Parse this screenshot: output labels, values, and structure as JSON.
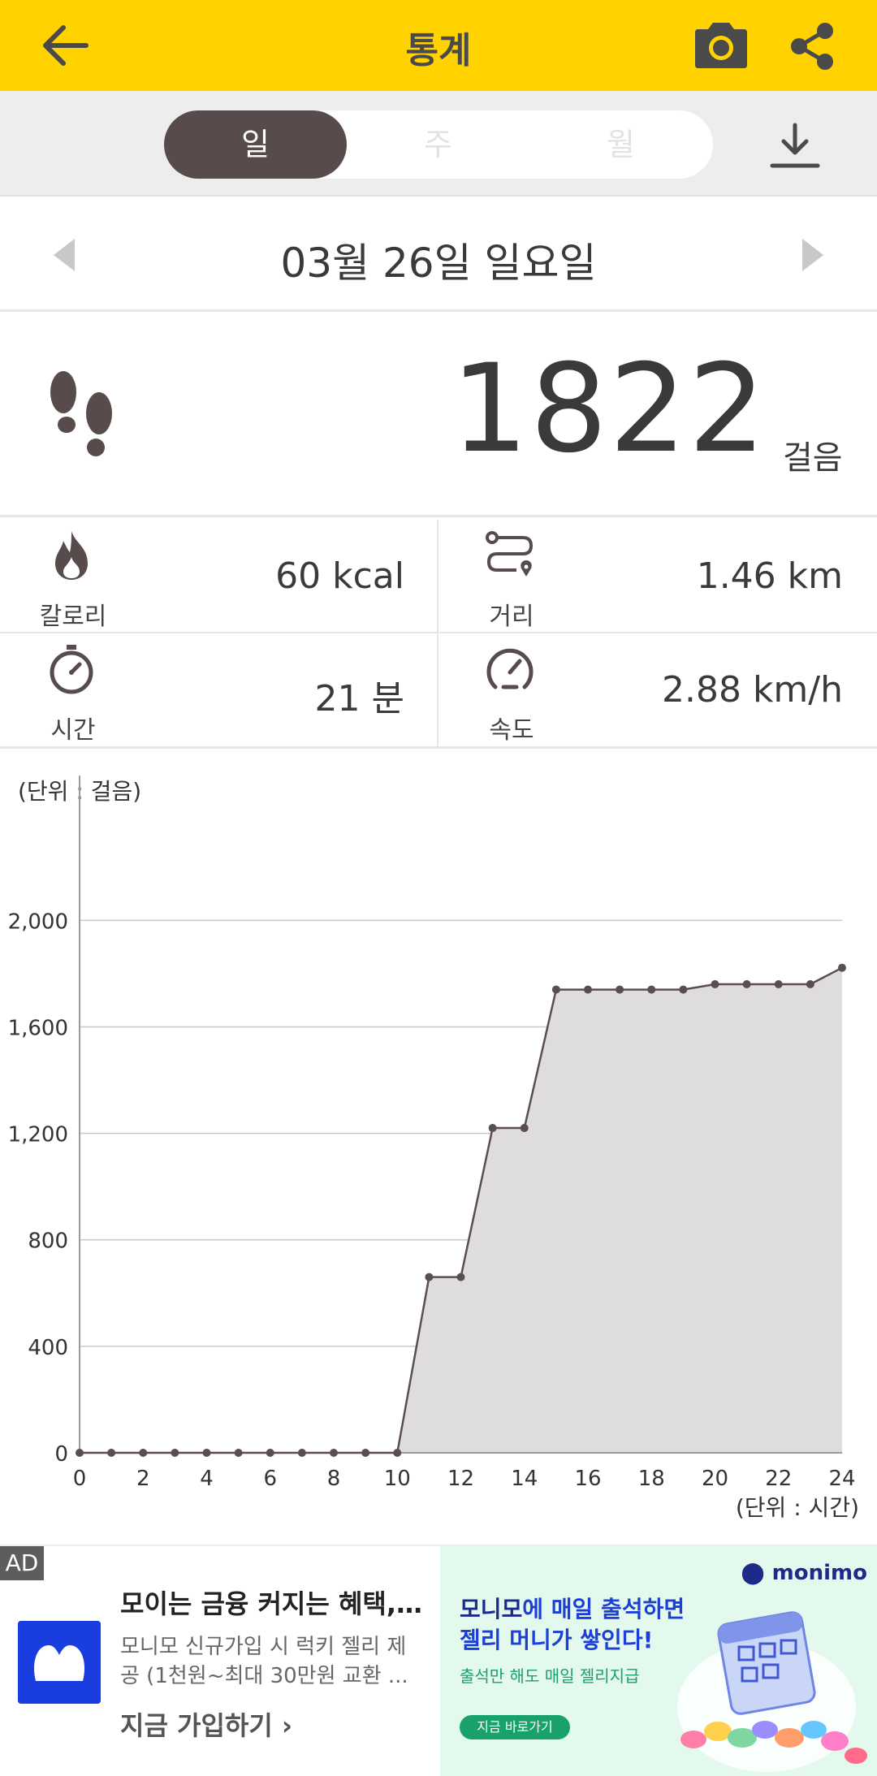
{
  "appbar": {
    "title": "통계"
  },
  "period_tabs": [
    "일",
    "주",
    "월"
  ],
  "active_tab": "일",
  "date": "03월 26일 일요일",
  "steps": {
    "count": "1822",
    "unit": "걸음"
  },
  "stats": {
    "calories": {
      "label": "칼로리",
      "value": "60 kcal"
    },
    "distance": {
      "label": "거리",
      "value": "1.46 km"
    },
    "time": {
      "label": "시간",
      "value": "21 분"
    },
    "speed": {
      "label": "속도",
      "value": "2.88 km/h"
    }
  },
  "chart_data": {
    "type": "area",
    "ylabel": "(단위 : 걸음)",
    "xlabel": "(단위 : 시간)",
    "x": [
      0,
      1,
      2,
      3,
      4,
      5,
      6,
      7,
      8,
      9,
      10,
      11,
      12,
      13,
      14,
      15,
      16,
      17,
      18,
      19,
      20,
      21,
      22,
      23,
      24
    ],
    "values": [
      0,
      0,
      0,
      0,
      0,
      0,
      0,
      0,
      0,
      0,
      0,
      660,
      660,
      1220,
      1220,
      1740,
      1740,
      1740,
      1740,
      1740,
      1760,
      1760,
      1760,
      1760,
      1822
    ],
    "xticks": [
      "0",
      "2",
      "4",
      "6",
      "8",
      "10",
      "12",
      "14",
      "16",
      "18",
      "20",
      "22",
      "24"
    ],
    "yticks": [
      "0",
      "400",
      "800",
      "1,200",
      "1,600",
      "2,000"
    ],
    "ylim": [
      0,
      2300
    ],
    "xlim": [
      0,
      24
    ],
    "grid": true,
    "colors": {
      "line": "#5a4e4e",
      "fill": "#dedcdc"
    }
  },
  "ad": {
    "tag": "AD",
    "headline": "모이는 금융 커지는 혜택, ...",
    "body_line1": "모니모 신규가입 시 럭키 젤리 제",
    "body_line2": "공 (1천원~최대 30만원 교환 ...",
    "cta": "지금 가입하기",
    "banner_brand": "monimo",
    "banner_line1_a": "모니모",
    "banner_line1_b": "에 매일 출석하면",
    "banner_line2": "젤리 머니가 쌓인다!",
    "banner_line3": "출석만 해도 매일 젤리지급",
    "banner_button": "지금 바로가기"
  },
  "colors": {
    "accent": "#FFD200",
    "primary_dark": "#574b4b"
  }
}
